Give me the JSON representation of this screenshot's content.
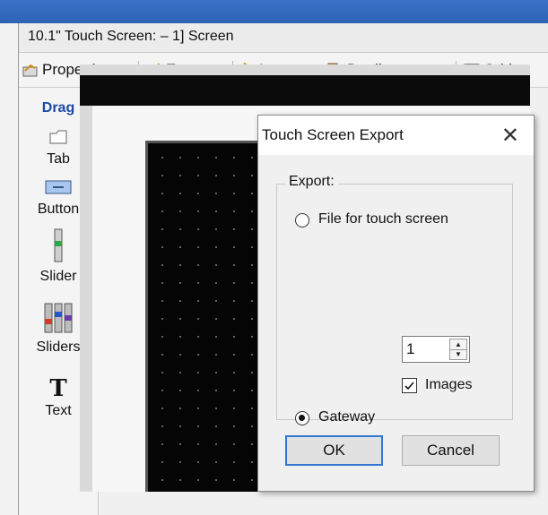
{
  "window": {
    "title": "10.1\" Touch Screen: – 1] Screen"
  },
  "toolbar": {
    "properties": "Properties",
    "export": "Export",
    "import": "Import",
    "duplicate": "Duplicate",
    "grid": "Grid"
  },
  "palette": {
    "header": "Drag",
    "items": [
      "Tab",
      "Button",
      "Slider",
      "Sliders",
      "Text"
    ],
    "text_glyph": "T"
  },
  "dialog": {
    "title": "Touch Screen Export",
    "close": "✕",
    "group_label": "Export:",
    "option_file": "File for touch screen",
    "option_gateway": "Gateway",
    "gateway_value": "1",
    "images_label": "Images",
    "images_checked": true,
    "selected_option": "Gateway",
    "ok": "OK",
    "cancel": "Cancel"
  },
  "colors": {
    "accent": "#2f76d1",
    "drag_header": "#1c4aa6",
    "title_band": "#2e62b3"
  }
}
